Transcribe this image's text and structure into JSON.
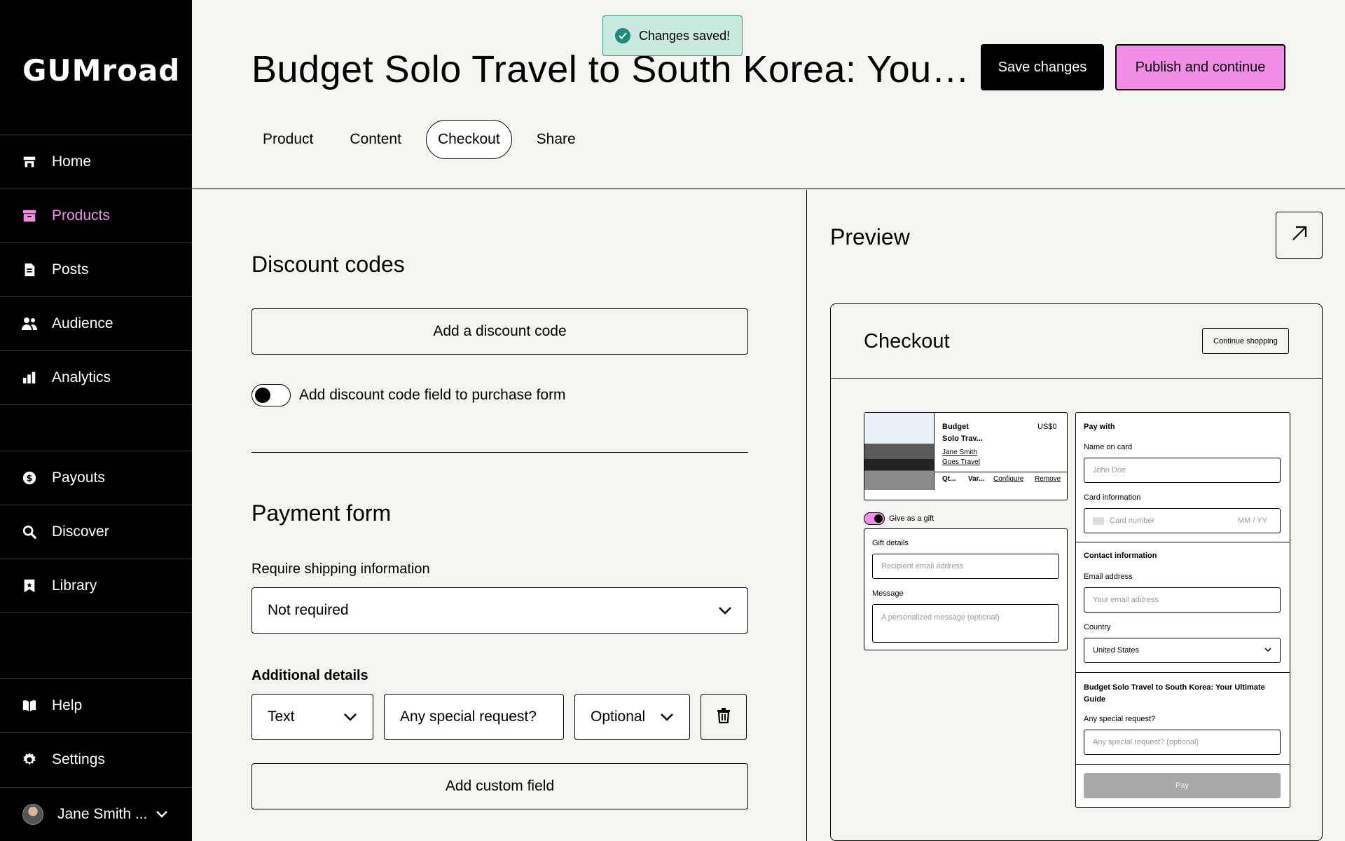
{
  "app": {
    "logo": "GUMroad"
  },
  "sidebar": {
    "items_top": [
      {
        "label": "Home",
        "icon": "store-icon"
      },
      {
        "label": "Products",
        "icon": "archive-icon",
        "active": true
      },
      {
        "label": "Posts",
        "icon": "document-icon"
      },
      {
        "label": "Audience",
        "icon": "people-icon"
      },
      {
        "label": "Analytics",
        "icon": "bar-chart-icon"
      }
    ],
    "items_mid": [
      {
        "label": "Payouts",
        "icon": "dollar-icon"
      },
      {
        "label": "Discover",
        "icon": "search-icon"
      },
      {
        "label": "Library",
        "icon": "bookmark-icon"
      }
    ],
    "items_bottom": [
      {
        "label": "Help",
        "icon": "book-icon"
      },
      {
        "label": "Settings",
        "icon": "gear-icon"
      }
    ],
    "user_name": "Jane Smith ..."
  },
  "header": {
    "title": "Budget Solo Travel to South Korea: Your ...",
    "save_label": "Save changes",
    "publish_label": "Publish and continue",
    "tabs": [
      "Product",
      "Content",
      "Checkout",
      "Share"
    ],
    "active_tab": "Checkout"
  },
  "toast": {
    "text": "Changes saved!"
  },
  "discount": {
    "heading": "Discount codes",
    "add_button": "Add a discount code",
    "toggle_label": "Add discount code field to purchase form"
  },
  "payment": {
    "heading": "Payment form",
    "shipping_label": "Require shipping information",
    "shipping_value": "Not required",
    "additional_label": "Additional details",
    "field_type": "Text",
    "field_value": "Any special request?",
    "field_required": "Optional",
    "add_custom": "Add custom field"
  },
  "preview": {
    "heading": "Preview",
    "checkout_title": "Checkout",
    "continue_shopping": "Continue shopping",
    "product_name_1": "Budget",
    "product_name_2": "Solo Trav...",
    "price": "US$0",
    "seller_1": "Jane Smith",
    "seller_2": "Goes Travel",
    "qty": "Qt...",
    "var": "Var...",
    "configure": "Configure",
    "remove": "Remove",
    "gift_toggle": "Give as a gift",
    "gift_details": "Gift details",
    "recipient_ph": "Recipient email address",
    "message_label": "Message",
    "message_ph": "A personalized message (optional)",
    "pay_with": "Pay with",
    "name_on_card": "Name on card",
    "name_ph": "John Doe",
    "card_info": "Card information",
    "card_ph": "Card number",
    "expiry_ph": "MM / YY",
    "contact_info": "Contact information",
    "email_label": "Email address",
    "email_ph": "Your email address",
    "country_label": "Country",
    "country_value": "United States",
    "product_full": "Budget Solo Travel to South Korea: Your Ultimate Guide",
    "special_label": "Any special request?",
    "special_ph": "Any special request? (optional)",
    "pay_button": "Pay"
  }
}
